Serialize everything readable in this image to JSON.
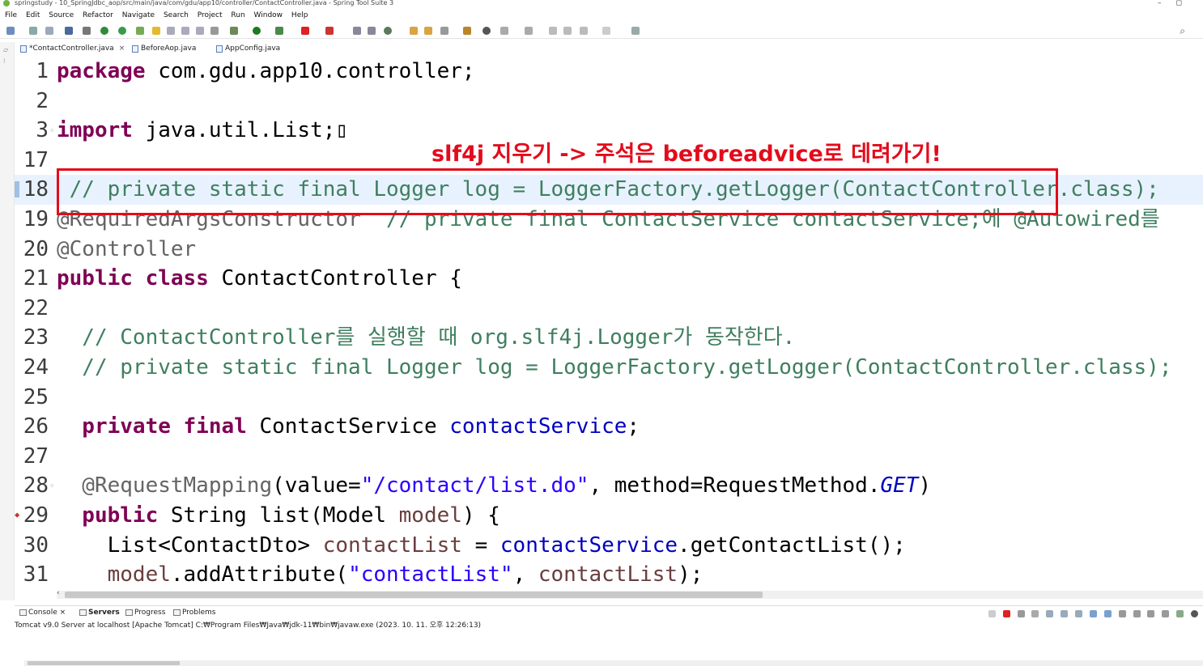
{
  "window": {
    "title": "springstudy - 10_SpringJdbc_aop/src/main/java/com/gdu/app10/controller/ContactController.java - Spring Tool Suite 3",
    "controls": [
      "–",
      "◻"
    ]
  },
  "menu": [
    "File",
    "Edit",
    "Source",
    "Refactor",
    "Navigate",
    "Search",
    "Project",
    "Run",
    "Window",
    "Help"
  ],
  "editor_tabs": [
    {
      "label": "*ContactController.java",
      "close": "×",
      "active": true
    },
    {
      "label": "BeforeAop.java",
      "active": false
    },
    {
      "label": "AppConfig.java",
      "active": false
    }
  ],
  "annotation": {
    "text": "slf4j 지우기 -> 주석은 beforeadvice로 데려가기!",
    "color": "#e30b1b"
  },
  "code_lines": [
    {
      "num": "1",
      "parts": [
        {
          "t": "package",
          "c": "kw"
        },
        {
          "t": " com.gdu.app10.controller;",
          "c": "pl"
        }
      ]
    },
    {
      "num": "2",
      "parts": []
    },
    {
      "num": "3",
      "fold": "◦",
      "parts": [
        {
          "t": "import",
          "c": "kw"
        },
        {
          "t": " java.util.List;",
          "c": "pl"
        },
        {
          "t": "▯",
          "c": "pl"
        }
      ]
    },
    {
      "num": "17",
      "parts": []
    },
    {
      "num": "18",
      "current": true,
      "parts": [
        {
          "t": " // private static final Logger log = LoggerFactory.getLogger(ContactController.class);",
          "c": "cm"
        }
      ]
    },
    {
      "num": "19",
      "parts": [
        {
          "t": "@RequiredArgsConstructor",
          "c": "ann"
        },
        {
          "t": "  // private final ContactService contactService;에 @Autowired를",
          "c": "cm"
        }
      ]
    },
    {
      "num": "20",
      "parts": [
        {
          "t": "@Controller",
          "c": "ann"
        }
      ]
    },
    {
      "num": "21",
      "parts": [
        {
          "t": "public class",
          "c": "kw"
        },
        {
          "t": " ContactController {",
          "c": "pl"
        }
      ]
    },
    {
      "num": "22",
      "parts": []
    },
    {
      "num": "23",
      "parts": [
        {
          "t": "  // ContactController를 실행할 때 org.slf4j.Logger가 동작한다.",
          "c": "cm"
        }
      ]
    },
    {
      "num": "24",
      "parts": [
        {
          "t": "  // private static final Logger log = LoggerFactory.getLogger(ContactController.class);",
          "c": "cm"
        }
      ]
    },
    {
      "num": "25",
      "parts": []
    },
    {
      "num": "26",
      "parts": [
        {
          "t": "  private final",
          "c": "kw"
        },
        {
          "t": " ContactService ",
          "c": "pl"
        },
        {
          "t": "contactService",
          "c": "fld"
        },
        {
          "t": ";",
          "c": "pl"
        }
      ]
    },
    {
      "num": "27",
      "parts": []
    },
    {
      "num": "28",
      "fold": "◦",
      "parts": [
        {
          "t": "  @RequestMapping",
          "c": "ann"
        },
        {
          "t": "(value=",
          "c": "pl"
        },
        {
          "t": "\"/contact/list.do\"",
          "c": "str"
        },
        {
          "t": ", method=RequestMethod.",
          "c": "pl"
        },
        {
          "t": "GET",
          "c": "st"
        },
        {
          "t": ")",
          "c": "pl"
        }
      ]
    },
    {
      "num": "29",
      "marker": "⬥",
      "parts": [
        {
          "t": "  public",
          "c": "kw"
        },
        {
          "t": " String list(Model ",
          "c": "pl"
        },
        {
          "t": "model",
          "c": "local"
        },
        {
          "t": ") {",
          "c": "pl"
        }
      ]
    },
    {
      "num": "30",
      "parts": [
        {
          "t": "    List<ContactDto> ",
          "c": "pl"
        },
        {
          "t": "contactList",
          "c": "local"
        },
        {
          "t": " = ",
          "c": "pl"
        },
        {
          "t": "contactService",
          "c": "fld"
        },
        {
          "t": ".getContactList();",
          "c": "pl"
        }
      ]
    },
    {
      "num": "31",
      "parts": [
        {
          "t": "    ",
          "c": "pl"
        },
        {
          "t": "model",
          "c": "local"
        },
        {
          "t": ".addAttribute(",
          "c": "pl"
        },
        {
          "t": "\"contactList\"",
          "c": "str"
        },
        {
          "t": ", ",
          "c": "pl"
        },
        {
          "t": "contactList",
          "c": "local"
        },
        {
          "t": ");",
          "c": "pl"
        }
      ]
    }
  ],
  "console": {
    "tabs": [
      {
        "label": "Console",
        "close": "×"
      },
      {
        "label": "Servers",
        "active": true
      },
      {
        "label": "Progress"
      },
      {
        "label": "Problems"
      }
    ],
    "status": "Tomcat v9.0 Server at localhost [Apache Tomcat] C:₩Program Files₩Java₩jdk-11₩bin₩javaw.exe  (2023. 10. 11. 오후 12:26:13)"
  }
}
